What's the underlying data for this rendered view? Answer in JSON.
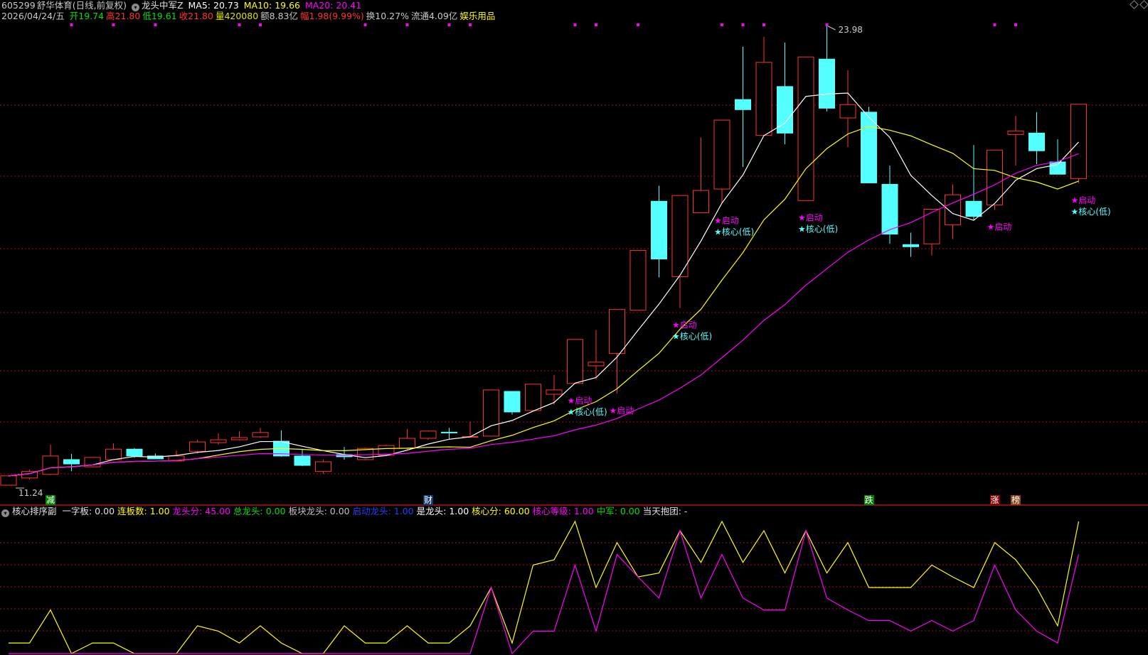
{
  "header": {
    "code": "605299",
    "name": "舒华体育",
    "period": "(日线,前复权)",
    "indicator": "龙头中军Z",
    "ma5": "MA5: 20.73",
    "ma10": "MA10: 19.66",
    "ma20": "MA20: 20.41",
    "date": "2026/04/24/五",
    "open": "开19.74",
    "high": "高21.80",
    "low": "低19.61",
    "close": "收21.80",
    "volume": "量420080",
    "amount": "额8.83亿",
    "change": "幅1.98(9.99%)",
    "turnover": "换10.27%",
    "float": "流通4.09亿",
    "sector": "娱乐用品"
  },
  "lower_header": {
    "title": "核心排序副",
    "items": [
      {
        "text": "一字板: 0.00",
        "color": "#e0e0e0"
      },
      {
        "text": "连板数: 1.00",
        "color": "#ffff00"
      },
      {
        "text": "龙头分: 45.00",
        "color": "#ff00ff"
      },
      {
        "text": "总龙头: 0.00",
        "color": "#00e000"
      },
      {
        "text": "板块龙头: 0.00",
        "color": "#c0c0c0"
      },
      {
        "text": "启动龙头: 1.00",
        "color": "#2040ff"
      },
      {
        "text": "是龙头: 1.00",
        "color": "#ffffff"
      },
      {
        "text": "核心分: 60.00",
        "color": "#ffff00"
      },
      {
        "text": "核心等级: 1.00",
        "color": "#ff00ff"
      },
      {
        "text": "中军: 0.00",
        "color": "#00e000"
      },
      {
        "text": "当天抱团: -",
        "color": "#e0e0e0"
      }
    ]
  },
  "tags": [
    {
      "index": 2,
      "text": "减",
      "bg": "#008000"
    },
    {
      "index": 20,
      "text": "财",
      "bg": "#103a70"
    },
    {
      "index": 41,
      "text": "跌",
      "bg": "#008000"
    },
    {
      "index": 47,
      "text": "涨",
      "bg": "#8b0000"
    },
    {
      "index": 48,
      "text": "榜",
      "bg": "#8b4513"
    }
  ],
  "colors": {
    "up": "#ff3232",
    "down": "#54ffff",
    "ma5": "#ffffff",
    "ma10": "#ffff00",
    "ma20": "#ff00ff",
    "grid": "#a01010"
  },
  "chart_data": {
    "type": "candlestick",
    "price_range": [
      11.24,
      23.98
    ],
    "high_label": "23.98",
    "low_label": "11.24",
    "candles": [
      [
        11.24,
        11.5,
        11.24,
        11.5
      ],
      [
        11.44,
        11.67,
        11.4,
        11.62
      ],
      [
        11.54,
        12.36,
        11.52,
        12.05
      ],
      [
        11.95,
        12.11,
        11.63,
        11.83
      ],
      [
        11.75,
        12.01,
        11.73,
        12.01
      ],
      [
        11.95,
        12.4,
        11.95,
        12.24
      ],
      [
        12.24,
        12.27,
        12.0,
        12.05
      ],
      [
        12.05,
        12.12,
        11.97,
        11.97
      ],
      [
        11.91,
        12.2,
        11.91,
        12.05
      ],
      [
        12.18,
        12.5,
        12.12,
        12.44
      ],
      [
        12.42,
        12.68,
        12.36,
        12.5
      ],
      [
        12.5,
        12.74,
        12.48,
        12.56
      ],
      [
        12.58,
        12.83,
        12.56,
        12.7
      ],
      [
        12.46,
        12.76,
        12.03,
        12.05
      ],
      [
        12.05,
        12.24,
        11.77,
        11.79
      ],
      [
        11.62,
        11.95,
        11.55,
        11.89
      ],
      [
        12.09,
        12.3,
        11.95,
        12.03
      ],
      [
        11.95,
        12.28,
        11.93,
        12.26
      ],
      [
        12.07,
        12.36,
        12.05,
        12.34
      ],
      [
        12.26,
        12.8,
        12.22,
        12.54
      ],
      [
        12.54,
        12.76,
        12.5,
        12.74
      ],
      [
        12.71,
        12.83,
        12.52,
        12.69
      ],
      [
        12.58,
        13.0,
        12.56,
        12.59
      ],
      [
        12.6,
        13.88,
        12.6,
        13.88
      ],
      [
        13.84,
        13.84,
        13.2,
        13.27
      ],
      [
        13.31,
        14.04,
        13.28,
        14.04
      ],
      [
        13.76,
        14.3,
        13.47,
        13.88
      ],
      [
        14.06,
        15.28,
        14.06,
        15.28
      ],
      [
        14.55,
        15.54,
        14.18,
        14.65
      ],
      [
        14.89,
        16.11,
        13.78,
        16.11
      ],
      [
        16.09,
        17.75,
        16.09,
        17.75
      ],
      [
        19.11,
        19.54,
        17.0,
        17.51
      ],
      [
        17.02,
        19.27,
        16.15,
        19.27
      ],
      [
        18.79,
        20.88,
        18.79,
        19.41
      ],
      [
        19.45,
        21.36,
        19.05,
        21.36
      ],
      [
        21.93,
        23.39,
        20.06,
        21.65
      ],
      [
        20.94,
        23.67,
        20.94,
        22.96
      ],
      [
        22.29,
        23.51,
        20.69,
        21.0
      ],
      [
        19.13,
        23.11,
        19.13,
        23.11
      ],
      [
        23.05,
        23.98,
        21.6,
        21.69
      ],
      [
        21.42,
        22.74,
        20.61,
        21.79
      ],
      [
        21.58,
        21.73,
        19.62,
        19.62
      ],
      [
        19.58,
        20.1,
        17.93,
        18.2
      ],
      [
        17.91,
        18.24,
        17.57,
        17.85
      ],
      [
        17.93,
        18.89,
        17.61,
        18.89
      ],
      [
        18.46,
        19.58,
        18.06,
        19.29
      ],
      [
        19.11,
        20.67,
        18.6,
        18.69
      ],
      [
        19.01,
        20.53,
        18.87,
        20.53
      ],
      [
        20.96,
        21.48,
        20.1,
        21.06
      ],
      [
        21.0,
        21.58,
        20.14,
        20.51
      ],
      [
        20.2,
        20.83,
        19.86,
        19.86
      ],
      [
        19.74,
        21.8,
        19.61,
        21.8
      ]
    ],
    "candle_fields": [
      "open",
      "high",
      "low",
      "close"
    ],
    "ma_periods": [
      5,
      10,
      20
    ],
    "signals": [
      {
        "index": 27,
        "start": "★启动",
        "core": "★核心(低)"
      },
      {
        "index": 29,
        "start": "★启动",
        "core": ""
      },
      {
        "index": 32,
        "start": "★启动",
        "core": "★核心(低)"
      },
      {
        "index": 34,
        "start": "★启动",
        "core": "★核心(低)"
      },
      {
        "index": 38,
        "start": "★启动",
        "core": "★核心(低)"
      },
      {
        "index": 47,
        "start": "★启动",
        "core": ""
      },
      {
        "index": 51,
        "start": "★启动",
        "core": "★核心(低)"
      }
    ],
    "top_markers": [
      3,
      5,
      7,
      11,
      12,
      17,
      19,
      21,
      22,
      27,
      28,
      30,
      34,
      35,
      36,
      39,
      47,
      48
    ],
    "lower_panel": {
      "range": [
        0,
        100
      ],
      "series": [
        {
          "name": "yellow",
          "color": "#ffff00",
          "values": [
            8,
            8,
            33,
            0,
            8,
            8,
            0,
            0,
            0,
            21,
            17,
            8,
            21,
            8,
            0,
            0,
            21,
            8,
            8,
            21,
            8,
            8,
            21,
            50,
            8,
            67,
            71,
            100,
            50,
            84,
            58,
            61,
            93,
            69,
            100,
            69,
            93,
            61,
            93,
            61,
            84,
            50,
            50,
            50,
            67,
            58,
            50,
            84,
            71,
            50,
            21,
            100
          ]
        },
        {
          "name": "magenta",
          "color": "#ff00ff",
          "values": [
            0,
            0,
            0,
            0,
            0,
            0,
            0,
            0,
            0,
            0,
            0,
            0,
            0,
            0,
            0,
            0,
            0,
            0,
            0,
            0,
            0,
            0,
            0,
            50,
            0,
            17,
            17,
            67,
            17,
            75,
            58,
            42,
            93,
            42,
            75,
            42,
            33,
            33,
            93,
            42,
            33,
            25,
            25,
            17,
            25,
            17,
            25,
            67,
            33,
            17,
            8,
            75
          ]
        }
      ]
    }
  }
}
